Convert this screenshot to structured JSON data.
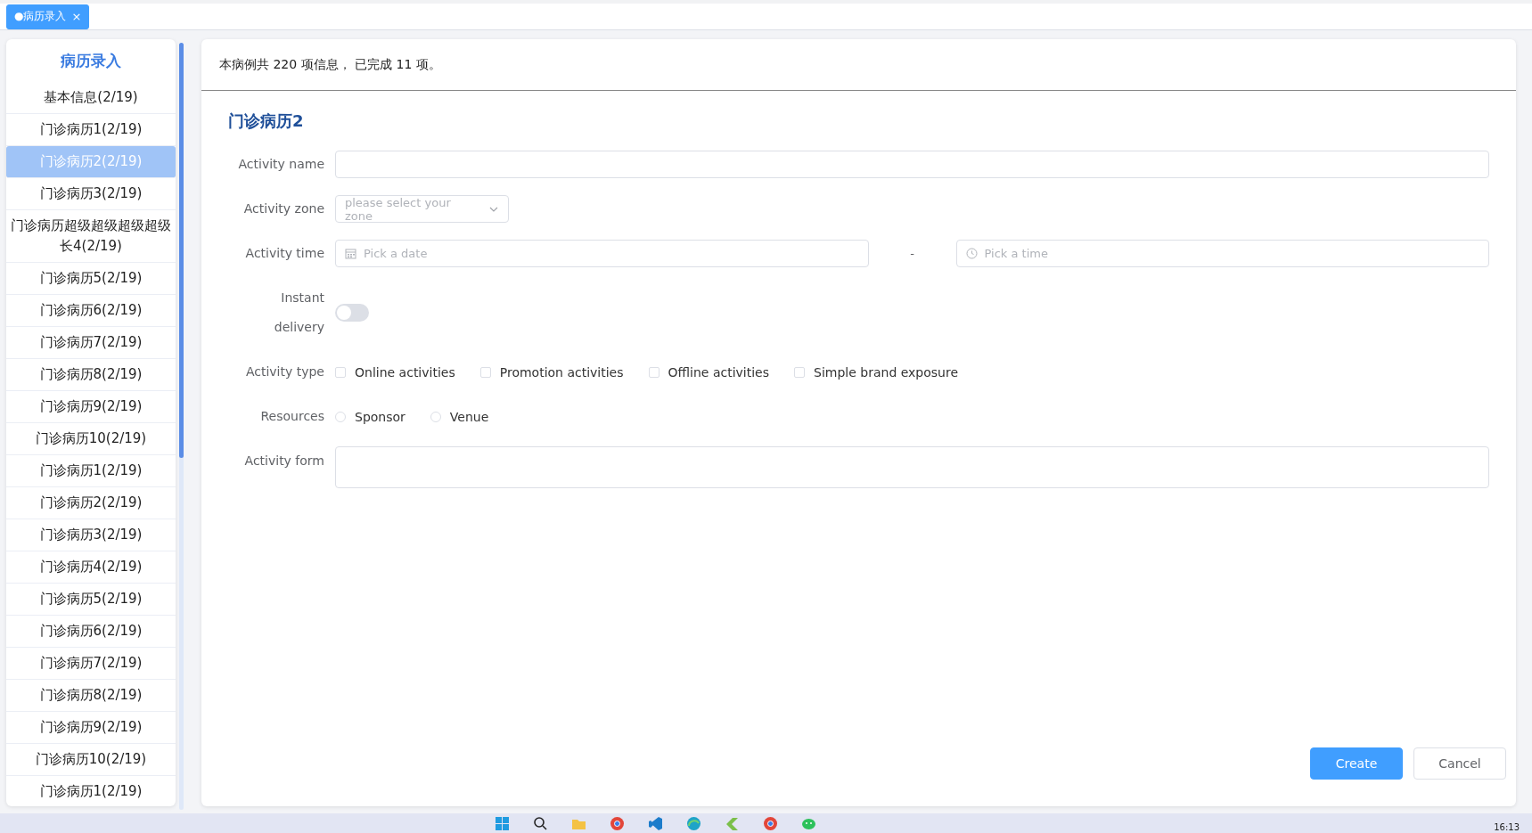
{
  "tabs": [
    {
      "label": "●病历录入",
      "selected": true,
      "close": "×"
    }
  ],
  "sidebar": {
    "title": "病历录入",
    "items": [
      {
        "label": "基本信息(2/19)",
        "selected": false
      },
      {
        "label": "门诊病历1(2/19)",
        "selected": false
      },
      {
        "label": "门诊病历2(2/19)",
        "selected": true
      },
      {
        "label": "门诊病历3(2/19)",
        "selected": false
      },
      {
        "label": "门诊病历超级超级超级超级长4(2/19)",
        "selected": false
      },
      {
        "label": "门诊病历5(2/19)",
        "selected": false
      },
      {
        "label": "门诊病历6(2/19)",
        "selected": false
      },
      {
        "label": "门诊病历7(2/19)",
        "selected": false
      },
      {
        "label": "门诊病历8(2/19)",
        "selected": false
      },
      {
        "label": "门诊病历9(2/19)",
        "selected": false
      },
      {
        "label": "门诊病历10(2/19)",
        "selected": false
      },
      {
        "label": "门诊病历1(2/19)",
        "selected": false
      },
      {
        "label": "门诊病历2(2/19)",
        "selected": false
      },
      {
        "label": "门诊病历3(2/19)",
        "selected": false
      },
      {
        "label": "门诊病历4(2/19)",
        "selected": false
      },
      {
        "label": "门诊病历5(2/19)",
        "selected": false
      },
      {
        "label": "门诊病历6(2/19)",
        "selected": false
      },
      {
        "label": "门诊病历7(2/19)",
        "selected": false
      },
      {
        "label": "门诊病历8(2/19)",
        "selected": false
      },
      {
        "label": "门诊病历9(2/19)",
        "selected": false
      },
      {
        "label": "门诊病历10(2/19)",
        "selected": false
      },
      {
        "label": "门诊病历1(2/19)",
        "selected": false
      }
    ]
  },
  "header": {
    "summary": "本病例共 220 项信息， 已完成 11 项。"
  },
  "form": {
    "title": "门诊病历2",
    "fields": [
      {
        "kind": "text",
        "label": "Activity name"
      },
      {
        "kind": "select",
        "label": "Activity zone",
        "placeholder": "please select your zone"
      },
      {
        "kind": "datetime",
        "label": "Activity time",
        "date_placeholder": "Pick a date",
        "separator": "-",
        "time_placeholder": "Pick a time"
      },
      {
        "kind": "switch",
        "label": "Instant delivery",
        "on": false
      },
      {
        "kind": "checkboxes",
        "label": "Activity type",
        "options": [
          {
            "label": "Online activities",
            "checked": false
          },
          {
            "label": "Promotion activities",
            "checked": false
          },
          {
            "label": "Offline activities",
            "checked": false
          },
          {
            "label": "Simple brand exposure",
            "checked": false
          }
        ]
      },
      {
        "kind": "radios",
        "label": "Resources",
        "options": [
          {
            "label": "Sponsor",
            "selected": false
          },
          {
            "label": "Venue",
            "selected": false
          }
        ]
      },
      {
        "kind": "textarea",
        "label": "Activity form"
      }
    ]
  },
  "buttons": [
    {
      "label": "Create",
      "kind": "primary"
    },
    {
      "label": "Cancel",
      "kind": "default"
    }
  ],
  "taskbar": {
    "clock": "16:13"
  }
}
